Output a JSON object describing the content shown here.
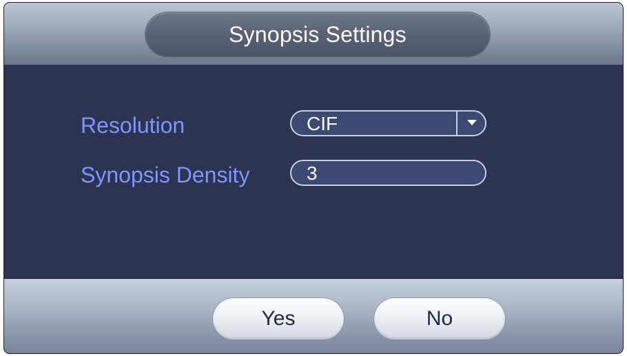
{
  "dialog": {
    "title": "Synopsis Settings"
  },
  "form": {
    "resolution": {
      "label": "Resolution",
      "value": "CIF"
    },
    "density": {
      "label": "Synopsis Density",
      "value": "3"
    }
  },
  "buttons": {
    "yes_label": "Yes",
    "no_label": "No"
  },
  "icons": {
    "dropdown": "chevron-down-icon"
  },
  "colors": {
    "label_text": "#7b97ff",
    "panel_background": "#2d3452",
    "field_background": "#3c4a72"
  }
}
